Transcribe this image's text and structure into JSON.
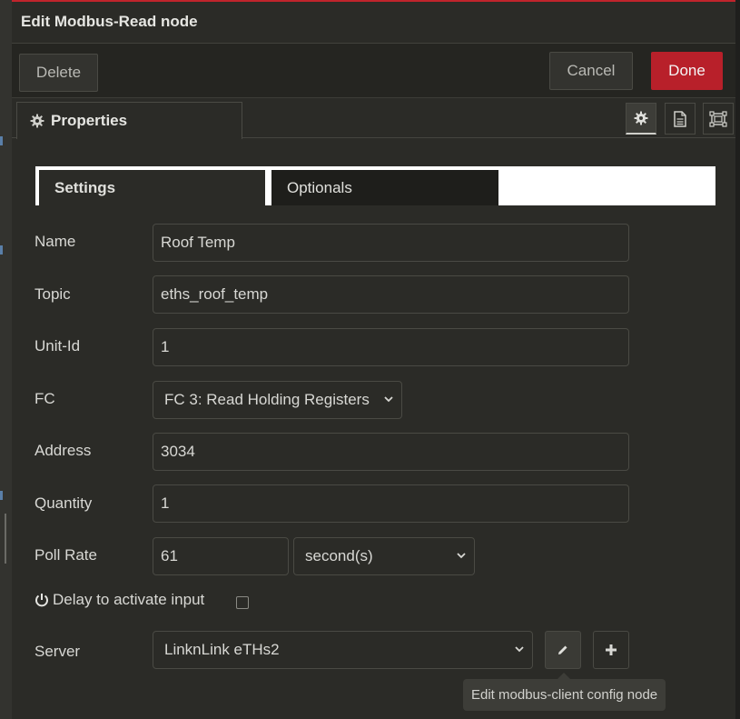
{
  "dialog": {
    "title": "Edit Modbus-Read node",
    "buttons": {
      "delete": "Delete",
      "cancel": "Cancel",
      "done": "Done"
    }
  },
  "tabs": {
    "properties": "Properties",
    "icons": [
      "settings-icon",
      "description-icon",
      "appearance-icon"
    ]
  },
  "subtabs": {
    "settings": "Settings",
    "optionals": "Optionals"
  },
  "form": {
    "name": {
      "label": "Name",
      "value": "Roof Temp"
    },
    "topic": {
      "label": "Topic",
      "value": "eths_roof_temp"
    },
    "unit_id": {
      "label": "Unit-Id",
      "value": "1"
    },
    "fc": {
      "label": "FC",
      "value": "FC 3: Read Holding Registers"
    },
    "address": {
      "label": "Address",
      "value": "3034"
    },
    "quantity": {
      "label": "Quantity",
      "value": "1"
    },
    "poll_rate": {
      "label": "Poll Rate",
      "value": "61",
      "unit": "second(s)"
    },
    "delay": {
      "label": "Delay to activate input",
      "checked": false
    },
    "server": {
      "label": "Server",
      "value": "LinknLink eTHs2"
    }
  },
  "tooltip": "Edit modbus-client config node",
  "colors": {
    "accent": "#b8202a",
    "background": "#2b2b27",
    "border": "#4a4a44"
  }
}
